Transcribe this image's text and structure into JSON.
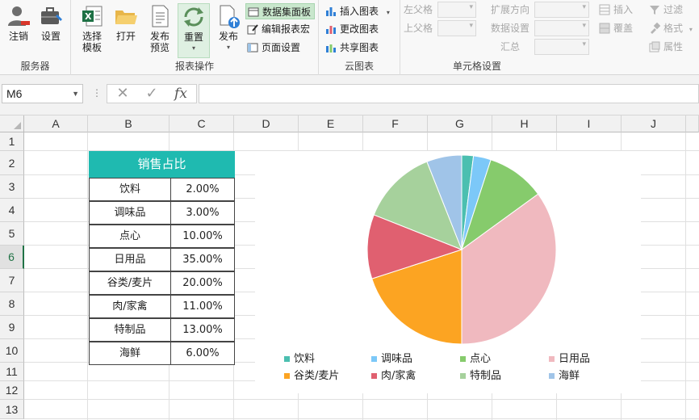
{
  "ribbon": {
    "groups": {
      "server": {
        "label": "服务器",
        "logout": "注销",
        "settings": "设置"
      },
      "report": {
        "label": "报表操作",
        "select_template_line1": "选择",
        "select_template_line2": "模板",
        "open": "打开",
        "publish_preview_line1": "发布",
        "publish_preview_line2": "预览",
        "reset": "重置",
        "publish": "发布",
        "data_panel": "数据集面板",
        "edit_macro": "编辑报表宏",
        "page_setup": "页面设置"
      },
      "cloud": {
        "label": "云图表",
        "insert_chart": "插入图表",
        "change_chart": "更改图表",
        "share_chart": "共享图表"
      },
      "cell": {
        "label": "单元格设置",
        "left_parent": "左父格",
        "top_parent": "上父格",
        "expand_dir": "扩展方向",
        "data_setting": "数据设置",
        "summary": "汇总",
        "insert": "插入",
        "cover": "覆盖",
        "filter": "过滤",
        "format": "格式",
        "property": "属性"
      }
    }
  },
  "formula_bar": {
    "name_box": "M6",
    "cancel_symbol": "✕",
    "enter_symbol": "✓",
    "fx_symbol": "fx",
    "dots": "⋮",
    "formula": ""
  },
  "sheet": {
    "columns": [
      "A",
      "B",
      "C",
      "D",
      "E",
      "F",
      "G",
      "H",
      "I",
      "J"
    ],
    "rows": [
      "1",
      "2",
      "3",
      "4",
      "5",
      "6",
      "7",
      "8",
      "9",
      "10",
      "11",
      "12",
      "13"
    ],
    "selected_row": "6",
    "table": {
      "title": "销售占比",
      "rows": [
        [
          "饮料",
          "2.00%"
        ],
        [
          "调味品",
          "3.00%"
        ],
        [
          "点心",
          "10.00%"
        ],
        [
          "日用品",
          "35.00%"
        ],
        [
          "谷类/麦片",
          "20.00%"
        ],
        [
          "肉/家禽",
          "11.00%"
        ],
        [
          "特制品",
          "13.00%"
        ],
        [
          "海鲜",
          "6.00%"
        ]
      ]
    }
  },
  "chart_data": {
    "type": "pie",
    "categories": [
      "饮料",
      "调味品",
      "点心",
      "日用品",
      "谷类/麦片",
      "肉/家禽",
      "特制品",
      "海鲜"
    ],
    "values": [
      2,
      3,
      10,
      35,
      20,
      11,
      13,
      6
    ],
    "colors": [
      "#4bbfb0",
      "#7cc8f8",
      "#86cb6c",
      "#f0b9bf",
      "#fca422",
      "#e06070",
      "#a6d19c",
      "#a0c4e8"
    ],
    "legend_position": "bottom",
    "title": ""
  },
  "accent": "#217346"
}
